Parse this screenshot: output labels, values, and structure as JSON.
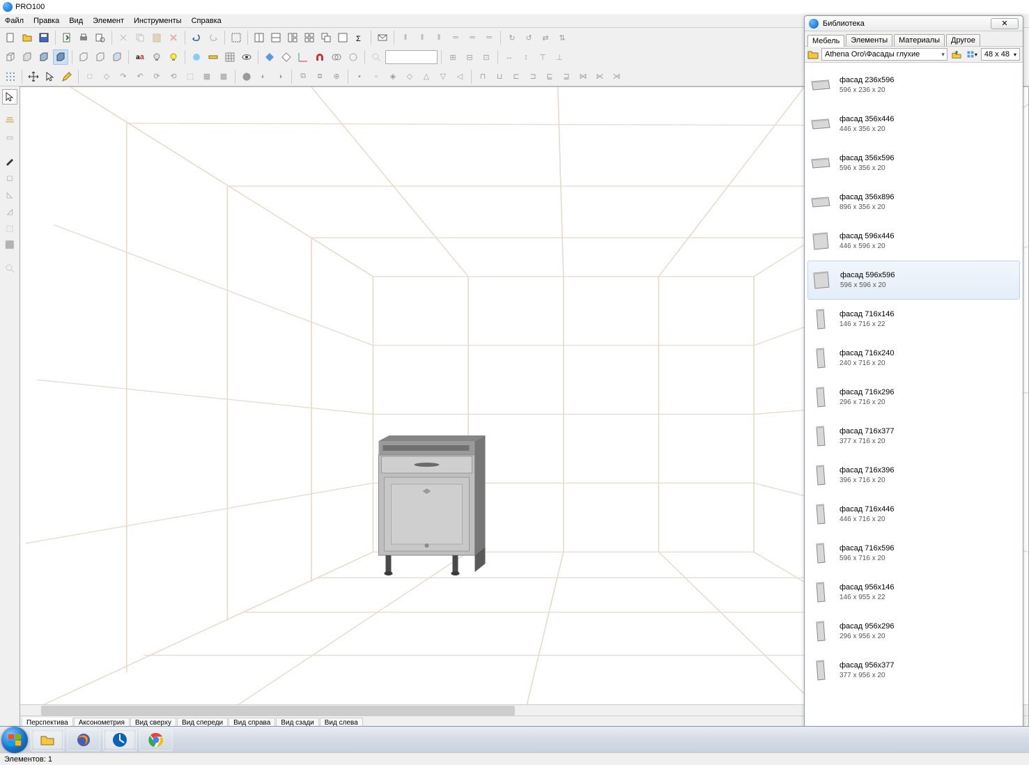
{
  "app": {
    "title": "PRO100"
  },
  "menu": [
    "Файл",
    "Правка",
    "Вид",
    "Элемент",
    "Инструменты",
    "Справка"
  ],
  "view_tabs": [
    "Перспектива",
    "Аксонометрия",
    "Вид сверху",
    "Вид спереди",
    "Вид справа",
    "Вид сзади",
    "Вид слева"
  ],
  "active_view_tab": 0,
  "status": "Элементов: 1",
  "library": {
    "title": "Библиотека",
    "tabs": [
      "Мебель",
      "Элементы",
      "Материалы",
      "Другое"
    ],
    "active_tab": 0,
    "path": "Athena Oro\\Фасады глухие",
    "size_label": "48 x  48",
    "selected_index": 5,
    "items": [
      {
        "name": "фасад 236x596",
        "dims": "596 x 236 x 20",
        "shape": "wide"
      },
      {
        "name": "фасад 356x446",
        "dims": "446 x 356 x 20",
        "shape": "wide"
      },
      {
        "name": "фасад 356x596",
        "dims": "596 x 356 x 20",
        "shape": "wide"
      },
      {
        "name": "фасад 356x896",
        "dims": "896 x 356 x 20",
        "shape": "wide"
      },
      {
        "name": "фасад 596x446",
        "dims": "446 x 596 x 20",
        "shape": "square"
      },
      {
        "name": "фасад 596x596",
        "dims": "596 x 596 x 20",
        "shape": "square"
      },
      {
        "name": "фасад 716x146",
        "dims": "146 x 716 x 22",
        "shape": "tall"
      },
      {
        "name": "фасад 716x240",
        "dims": "240 x 716 x 20",
        "shape": "tall"
      },
      {
        "name": "фасад 716x296",
        "dims": "296 x 716 x 20",
        "shape": "tall"
      },
      {
        "name": "фасад 716x377",
        "dims": "377 x 716 x 20",
        "shape": "tall"
      },
      {
        "name": "фасад 716x396",
        "dims": "396 x 716 x 20",
        "shape": "tall"
      },
      {
        "name": "фасад 716x446",
        "dims": "446 x 716 x 20",
        "shape": "tall"
      },
      {
        "name": "фасад 716x596",
        "dims": "596 x 716 x 20",
        "shape": "tall"
      },
      {
        "name": "фасад 956x146",
        "dims": "146 x 955 x 22",
        "shape": "tall"
      },
      {
        "name": "фасад 956x296",
        "dims": "296 x 956 x 20",
        "shape": "tall"
      },
      {
        "name": "фасад 956x377",
        "dims": "377 x 956 x 20",
        "shape": "tall"
      }
    ]
  }
}
